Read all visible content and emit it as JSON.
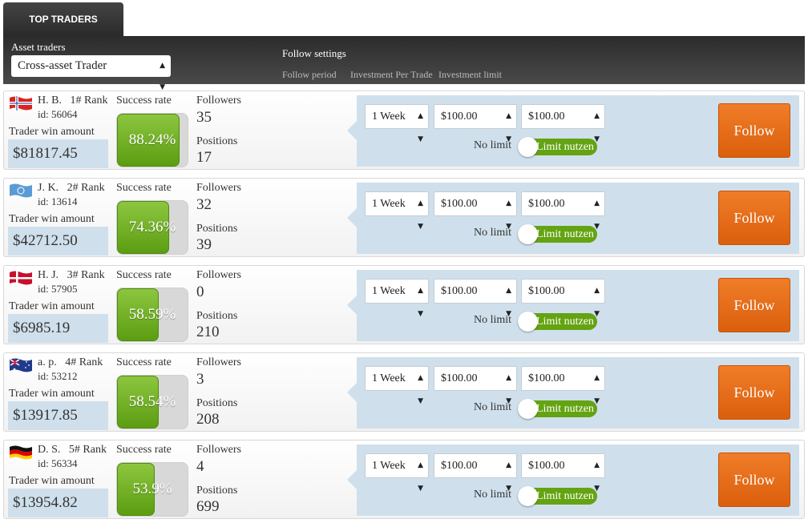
{
  "tabs": [
    {
      "label": "TOP TRADERS"
    }
  ],
  "filter": {
    "asset_label": "Asset traders",
    "asset_selected": "Cross-asset Trader",
    "follow_settings": "Follow settings",
    "columns": [
      "Follow period",
      "Investment Per Trade",
      "Investment limit"
    ]
  },
  "labels": {
    "success_rate": "Success rate",
    "followers": "Followers",
    "positions": "Positions",
    "win_amount": "Trader win amount",
    "no_limit": "No limit",
    "limit_toggle": "Limit nutzen",
    "follow": "Follow"
  },
  "colors": {
    "accent": "#e36a18",
    "success": "#6aab1b",
    "panel": "#cfe0ec"
  },
  "traders": [
    {
      "name": "H. B.",
      "rank": "1# Rank",
      "id": "id: 56064",
      "flag": "norway-flag-icon",
      "win_amount": "$81817.45",
      "success_rate": "88.24%",
      "success_value": 88.24,
      "followers": "35",
      "positions": "17",
      "period": "1 Week",
      "per_trade": "$100.00",
      "limit": "$100.00",
      "limit_enabled": true
    },
    {
      "name": "J. K.",
      "rank": "2# Rank",
      "id": "id: 13614",
      "flag": "un-flag-icon",
      "win_amount": "$42712.50",
      "success_rate": "74.36%",
      "success_value": 74.36,
      "followers": "32",
      "positions": "39",
      "period": "1 Week",
      "per_trade": "$100.00",
      "limit": "$100.00",
      "limit_enabled": true
    },
    {
      "name": "H. J.",
      "rank": "3# Rank",
      "id": "id: 57905",
      "flag": "denmark-flag-icon",
      "win_amount": "$6985.19",
      "success_rate": "58.59%",
      "success_value": 58.59,
      "followers": "0",
      "positions": "210",
      "period": "1 Week",
      "per_trade": "$100.00",
      "limit": "$100.00",
      "limit_enabled": true
    },
    {
      "name": "a. p.",
      "rank": "4# Rank",
      "id": "id: 53212",
      "flag": "australia-flag-icon",
      "win_amount": "$13917.85",
      "success_rate": "58.54%",
      "success_value": 58.54,
      "followers": "3",
      "positions": "208",
      "period": "1 Week",
      "per_trade": "$100.00",
      "limit": "$100.00",
      "limit_enabled": true
    },
    {
      "name": "D. S.",
      "rank": "5# Rank",
      "id": "id: 56334",
      "flag": "germany-flag-icon",
      "win_amount": "$13954.82",
      "success_rate": "53.9%",
      "success_value": 53.9,
      "followers": "4",
      "positions": "699",
      "period": "1 Week",
      "per_trade": "$100.00",
      "limit": "$100.00",
      "limit_enabled": true
    }
  ]
}
